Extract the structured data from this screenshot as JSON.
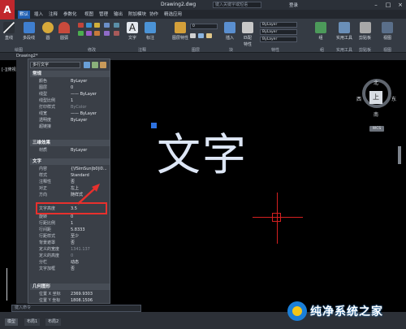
{
  "titlebar": {
    "app_logo": "A",
    "title": "Drawing2.dwg",
    "search_placeholder": "键入关键字或短语",
    "user": "登录"
  },
  "menu_tabs": [
    "默认",
    "插入",
    "注释",
    "参数化",
    "视图",
    "管理",
    "输出",
    "附加模块",
    "协作",
    "精选应用"
  ],
  "ribbon": {
    "buttons": [
      "直线",
      "多段线",
      "圆",
      "圆弧",
      "文字",
      "标注",
      "图层特性",
      "插入",
      "匹配",
      "特性",
      "组",
      "实用工具",
      "剪贴板",
      "视图"
    ],
    "panels": [
      "绘图",
      "修改",
      "注释",
      "图层",
      "块",
      "特性",
      "组",
      "实用工具",
      "剪贴板",
      "视图"
    ],
    "layer_field": "0",
    "color_field": "ByLayer",
    "linetype_field": "ByLayer",
    "lineweight_field": "ByLayer"
  },
  "file_tab": "Drawing2*",
  "viewport_label": "[-][俯视][二维线框]",
  "palette": {
    "object_type": "多行文字",
    "sections": {
      "general": "常规",
      "3d": "三维效果",
      "text": "文字",
      "geometry": "几何图形"
    },
    "general_rows": [
      {
        "k": "颜色",
        "v": "ByLayer"
      },
      {
        "k": "图层",
        "v": "0"
      },
      {
        "k": "线型",
        "v": "—— ByLayer"
      },
      {
        "k": "线型比例",
        "v": "1"
      },
      {
        "k": "打印样式",
        "v": "ByColor"
      },
      {
        "k": "线宽",
        "v": "—— ByLayer"
      },
      {
        "k": "透明度",
        "v": "ByLayer"
      },
      {
        "k": "超链接",
        "v": ""
      }
    ],
    "material_row": {
      "k": "材质",
      "v": "ByLayer"
    },
    "text_rows": [
      {
        "k": "内容",
        "v": "{\\fSimSun|b0|i0..."
      },
      {
        "k": "样式",
        "v": "Standard"
      },
      {
        "k": "注释性",
        "v": "否"
      },
      {
        "k": "对正",
        "v": "左上"
      },
      {
        "k": "方向",
        "v": "随样式"
      },
      {
        "k": "文字高度",
        "v": "3.5"
      },
      {
        "k": "旋转",
        "v": "0"
      },
      {
        "k": "行距比例",
        "v": "1"
      },
      {
        "k": "行间距",
        "v": "5.8333"
      },
      {
        "k": "行距样式",
        "v": "至少"
      },
      {
        "k": "背景遮罩",
        "v": "否"
      },
      {
        "k": "定义的宽度",
        "v": "1341.137"
      },
      {
        "k": "定义的高度",
        "v": "0"
      },
      {
        "k": "分栏",
        "v": "动态"
      },
      {
        "k": "文字加框",
        "v": "否"
      }
    ],
    "geometry_rows": [
      {
        "k": "位置 X 坐标",
        "v": "2369.9303"
      },
      {
        "k": "位置 Y 坐标",
        "v": "1808.1506"
      }
    ]
  },
  "canvas_text": "文字",
  "viewcube": {
    "north": "北",
    "south": "南",
    "west": "西",
    "east": "东",
    "top": "上",
    "wcs": "WCS"
  },
  "command_placeholder": "键入命令",
  "status_tabs": [
    "模型",
    "布局1",
    "布局2"
  ],
  "watermark": "纯净系统之家",
  "colors": {
    "accent": "#1f5fb3",
    "highlight": "#e8302d",
    "cursor": "#d42020",
    "grip": "#2d72e0"
  }
}
